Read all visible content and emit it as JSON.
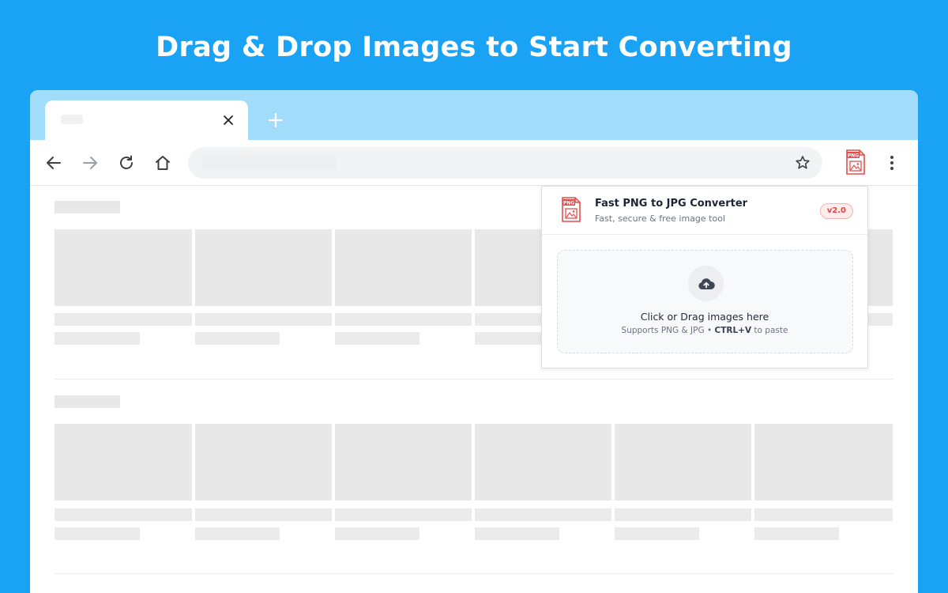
{
  "headline": "Drag & Drop Images to Start Converting",
  "browser": {
    "tab": {
      "title": "",
      "close_icon": "close-icon"
    },
    "new_tab_icon": "plus-icon",
    "toolbar": {
      "back_icon": "arrow-left-icon",
      "forward_icon": "arrow-right-icon",
      "reload_icon": "reload-icon",
      "home_icon": "home-icon",
      "address": "",
      "bookmark_icon": "star-icon",
      "extension_icon": "png-file-icon",
      "menu_icon": "kebab-menu-icon"
    }
  },
  "extension_popup": {
    "title": "Fast PNG to JPG Converter",
    "subtitle": "Fast, secure & free image tool",
    "version": "v2.0",
    "logo_text": "PNG",
    "dropzone": {
      "title": "Click or Drag images here",
      "hint_prefix": "Supports PNG & JPG",
      "hint_separator": "•",
      "hint_shortcut": "CTRL+V",
      "hint_suffix": "to paste"
    }
  },
  "colors": {
    "background": "#1aa3f5",
    "tabstrip": "#a2dcfb",
    "skeleton": "#e8e8e8",
    "badge_text": "#e24545",
    "logo_red": "#e74c4c"
  }
}
